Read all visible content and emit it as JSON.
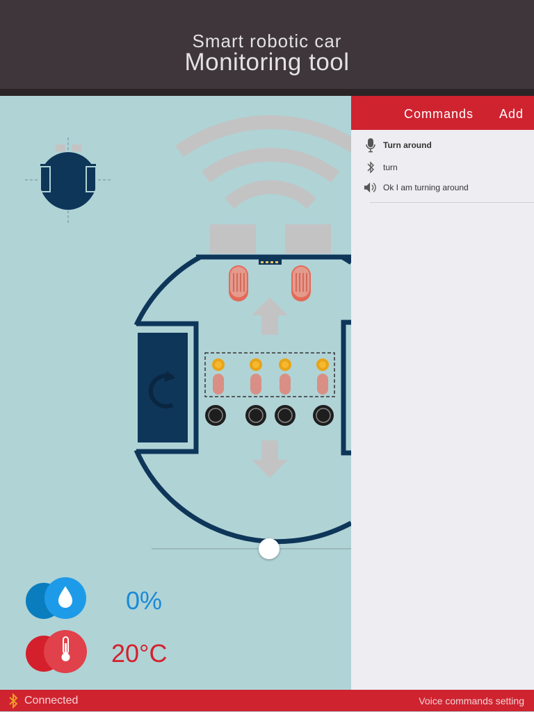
{
  "header": {
    "line1": "Smart robotic car",
    "line2": "Monitoring tool"
  },
  "commands_panel": {
    "title": "Commands",
    "add_label": "Add",
    "items": [
      {
        "icon": "microphone-icon",
        "text": "Turn around"
      },
      {
        "icon": "bluetooth-icon",
        "text": "turn"
      },
      {
        "icon": "speaker-icon",
        "text": "Ok I am turning around"
      }
    ]
  },
  "sensors": {
    "humidity": {
      "value": "0%",
      "icon": "water-drop-icon",
      "color": "#1b8ad6"
    },
    "temperature": {
      "value": "20°C",
      "icon": "thermometer-icon",
      "color": "#d4202c"
    }
  },
  "slider": {
    "value_fraction": 0.59
  },
  "footer": {
    "status": "Connected",
    "voice_setting": "Voice commands setting"
  },
  "colors": {
    "header_bg": "#3e363a",
    "accent_red": "#cf2330",
    "robot_navy": "#0e3659",
    "canvas_bg": "#b0d3d6",
    "led_orange": "#e8a417"
  }
}
